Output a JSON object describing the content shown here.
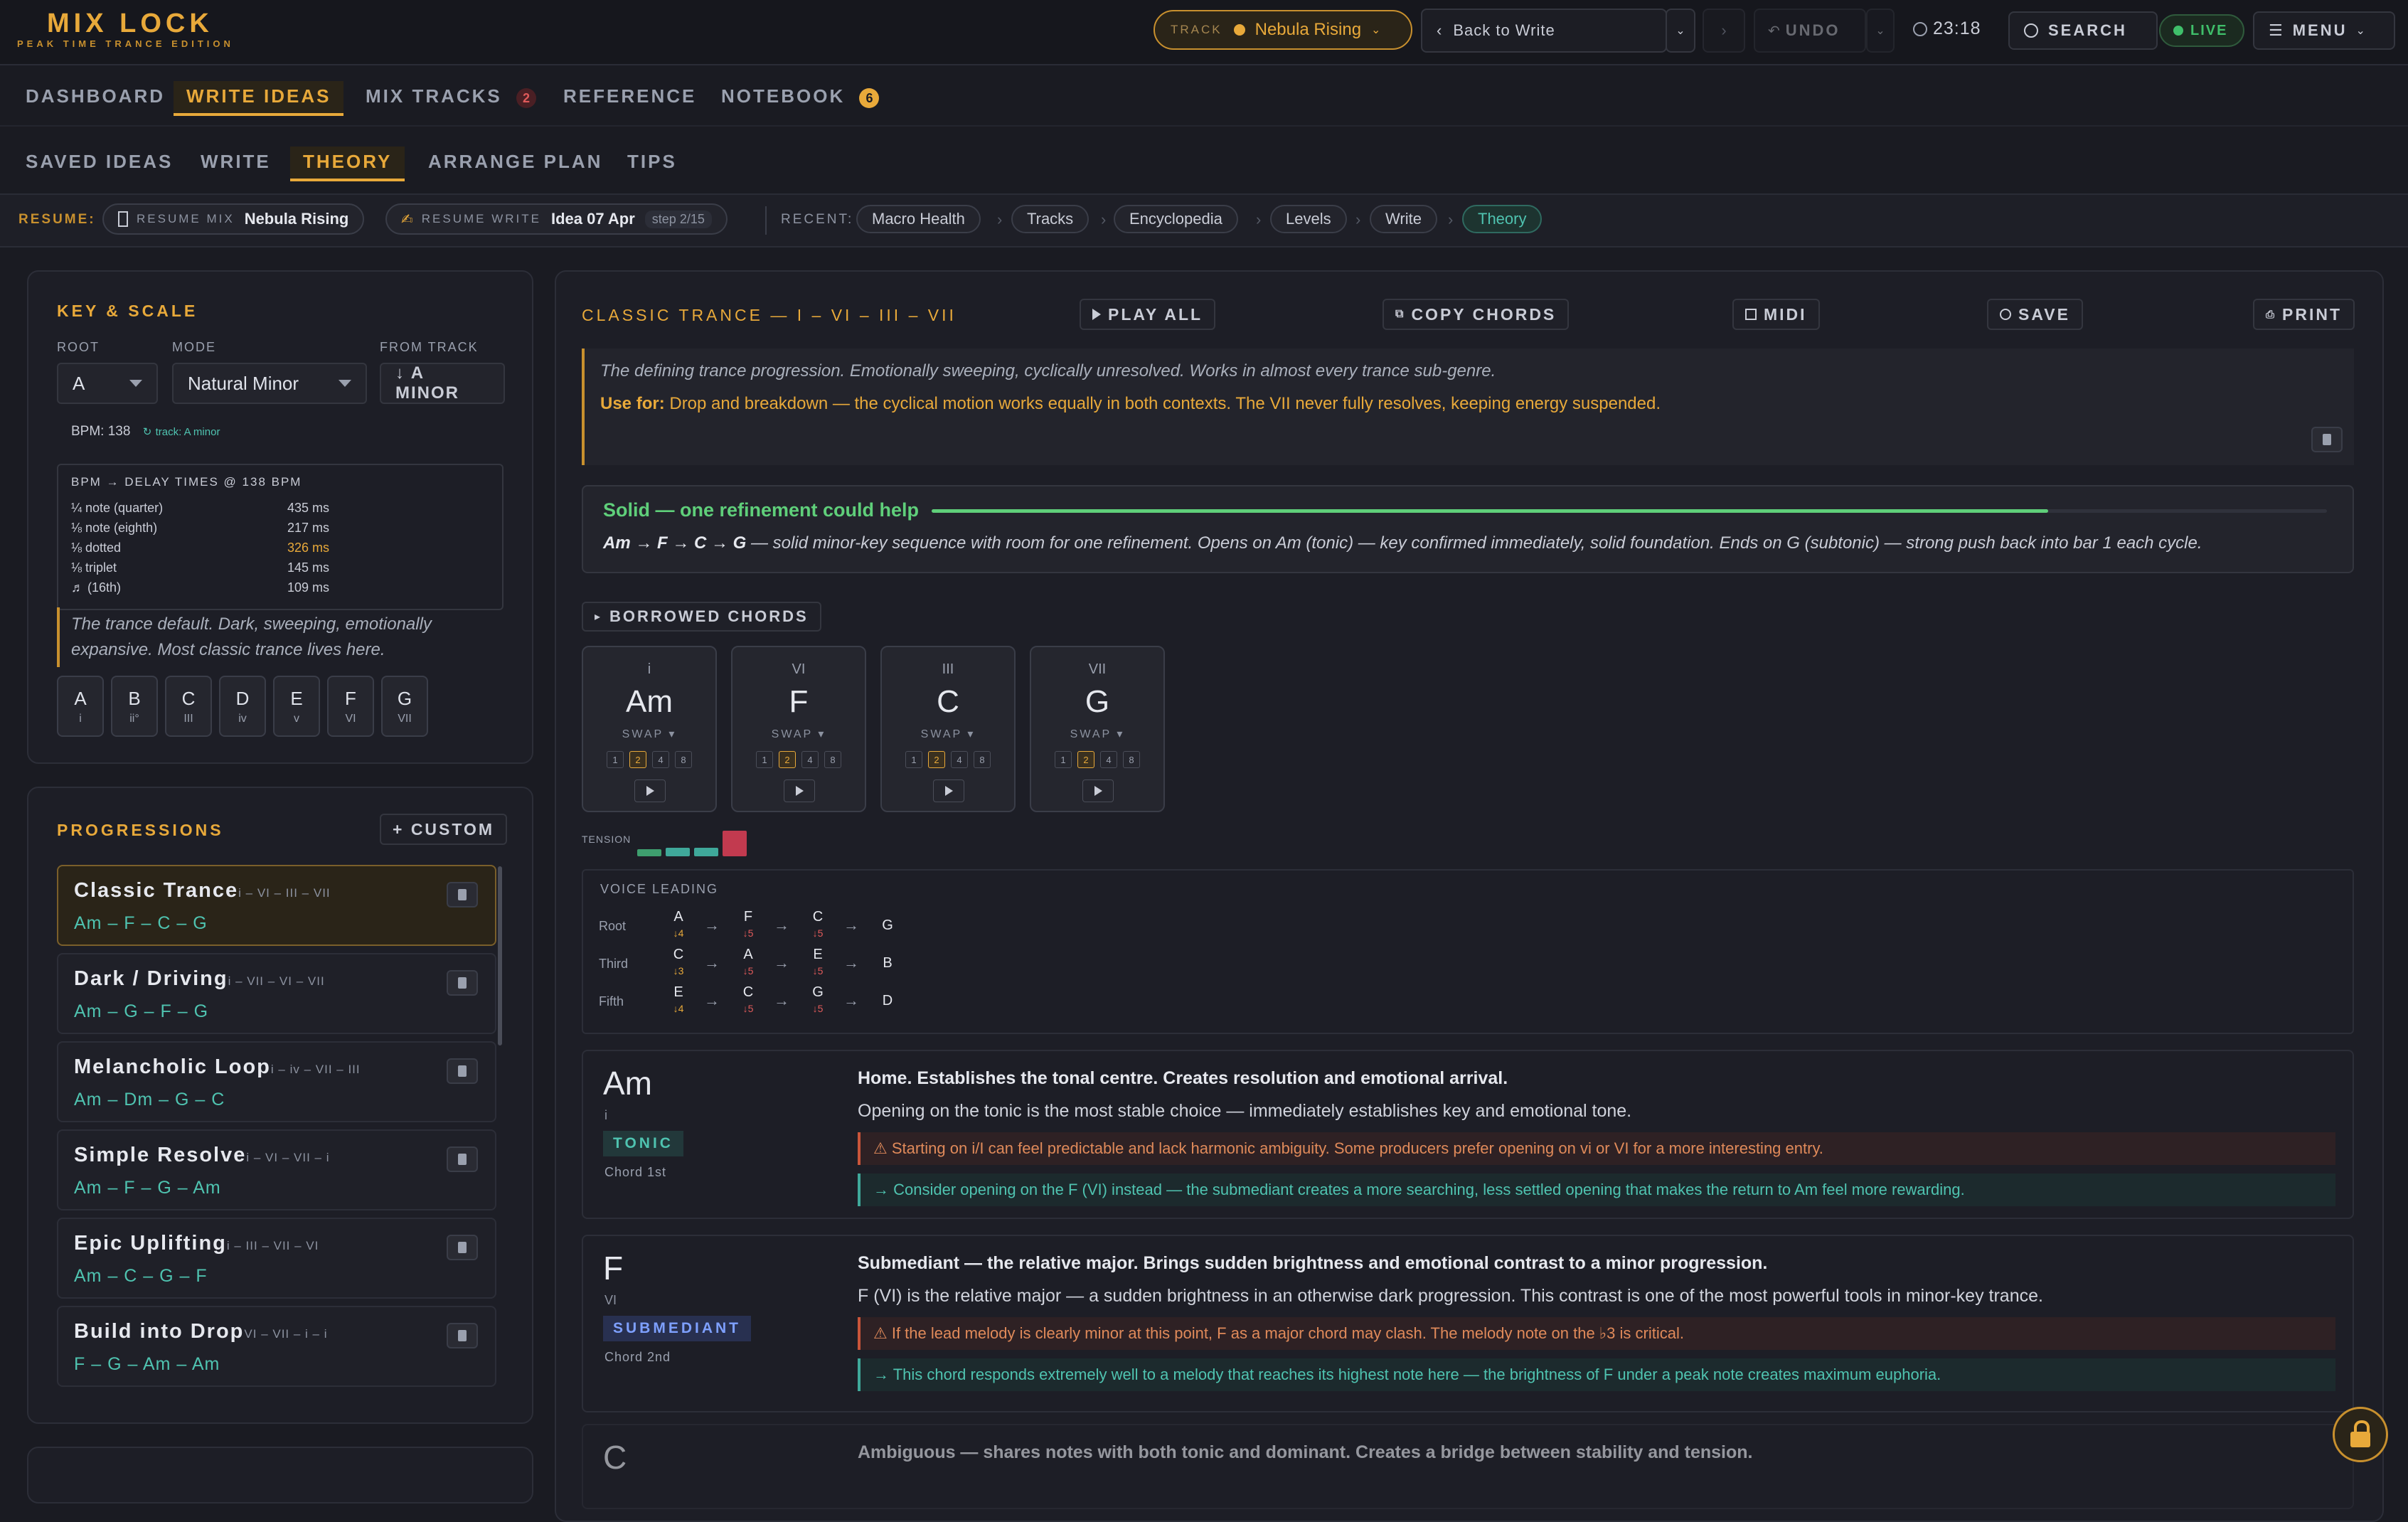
{
  "app": {
    "logo": "MIX LOCK",
    "logo_sub": "PEAK TIME TRANCE EDITION"
  },
  "topbar": {
    "track_label": "TRACK",
    "track_name": "Nebula Rising",
    "back_label": "Back to Write",
    "undo_label": "UNDO",
    "time": "23:18",
    "search_label": "SEARCH",
    "live_label": "LIVE",
    "menu_label": "MENU"
  },
  "nav_main": {
    "items": [
      {
        "label": "DASHBOARD"
      },
      {
        "label": "WRITE IDEAS"
      },
      {
        "label": "MIX TRACKS",
        "badge": "2"
      },
      {
        "label": "REFERENCE"
      },
      {
        "label": "NOTEBOOK",
        "badge": "6"
      }
    ]
  },
  "nav_sub": {
    "items": [
      {
        "label": "SAVED IDEAS"
      },
      {
        "label": "WRITE"
      },
      {
        "label": "THEORY"
      },
      {
        "label": "ARRANGE PLAN"
      },
      {
        "label": "TIPS"
      }
    ]
  },
  "resume": {
    "label": "RESUME:",
    "mix_tag": "RESUME MIX",
    "mix_name": "Nebula Rising",
    "write_tag": "RESUME WRITE",
    "write_name": "Idea 07 Apr",
    "write_step": "step 2/15",
    "recent_label": "RECENT:",
    "recent": [
      "Macro Health",
      "Tracks",
      "Encyclopedia",
      "Levels",
      "Write",
      "Theory"
    ]
  },
  "key_scale": {
    "title": "KEY & SCALE",
    "root_label": "ROOT",
    "root_value": "A",
    "mode_label": "MODE",
    "mode_value": "Natural Minor",
    "from_track_label": "FROM TRACK",
    "from_track_btn": "↓ A MINOR",
    "bpm_text": "BPM: 138",
    "bpm_track": "track: A minor",
    "delay_title": "BPM → DELAY TIMES @ 138 BPM",
    "delays": [
      {
        "note": "¼ note (quarter)",
        "ms": "435 ms"
      },
      {
        "note": "⅛ note (eighth)",
        "ms": "217 ms"
      },
      {
        "note": "⅛ dotted",
        "ms": "326 ms"
      },
      {
        "note": "⅛ triplet",
        "ms": "145 ms"
      },
      {
        "note": "♬ (16th)",
        "ms": "109 ms"
      }
    ],
    "description": "The trance default. Dark, sweeping, emotionally expansive. Most classic trance lives here.",
    "notes": [
      {
        "n": "A",
        "r": "i"
      },
      {
        "n": "B",
        "r": "ii°"
      },
      {
        "n": "C",
        "r": "III"
      },
      {
        "n": "D",
        "r": "iv"
      },
      {
        "n": "E",
        "r": "v"
      },
      {
        "n": "F",
        "r": "VI"
      },
      {
        "n": "G",
        "r": "VII"
      }
    ]
  },
  "progressions": {
    "title": "PROGRESSIONS",
    "custom_btn": "+ CUSTOM",
    "items": [
      {
        "name": "Classic Trance",
        "roman": "i – VI – III – VII",
        "chords": "Am – F – C – G"
      },
      {
        "name": "Dark / Driving",
        "roman": "i – VII – VI – VII",
        "chords": "Am – G – F – G"
      },
      {
        "name": "Melancholic Loop",
        "roman": "i – iv – VII – III",
        "chords": "Am – Dm – G – C"
      },
      {
        "name": "Simple Resolve",
        "roman": "i – VI – VII – i",
        "chords": "Am – F – G – Am"
      },
      {
        "name": "Epic Uplifting",
        "roman": "i – III – VII – VI",
        "chords": "Am – C – G – F"
      },
      {
        "name": "Build into Drop",
        "roman": "VI – VII – i – i",
        "chords": "F – G – Am – Am"
      }
    ]
  },
  "detail": {
    "title": "CLASSIC TRANCE — I – VI – III – VII",
    "buttons": {
      "play_all": "PLAY ALL",
      "copy": "COPY CHORDS",
      "midi": "MIDI",
      "save": "SAVE",
      "print": "PRINT"
    },
    "quote": "The defining trance progression. Emotionally sweeping, cyclically unresolved. Works in almost every trance sub-genre.",
    "use_for_label": "Use for:",
    "use_for_text": "Drop and breakdown — the cyclical motion works equally in both contexts. The VII never fully resolves, keeping energy suspended.",
    "assessment_title": "Solid — one refinement could help",
    "assessment_score": 0.8,
    "assessment_seq": "Am → F → C → G",
    "assessment_text": "— solid minor-key sequence with room for one refinement. Opens on Am (tonic) — key confirmed immediately, solid foundation. Ends on G (subtonic) — strong push back into bar 1 each cycle.",
    "borrowed_label": "BORROWED CHORDS",
    "chords": [
      {
        "roman": "i",
        "name": "Am",
        "swap": "SWAP ▾"
      },
      {
        "roman": "VI",
        "name": "F",
        "swap": "SWAP ▾"
      },
      {
        "roman": "III",
        "name": "C",
        "swap": "SWAP ▾"
      },
      {
        "roman": "VII",
        "name": "G",
        "swap": "SWAP ▾"
      }
    ],
    "beat_options": [
      "1",
      "2",
      "4",
      "8"
    ],
    "tension_label": "TENSION",
    "tension": [
      0.25,
      0.3,
      0.3,
      0.9
    ],
    "tension_colors": [
      "#3e9e6e",
      "#3fa89a",
      "#3fa89a",
      "#c23a4f"
    ],
    "voice_leading": {
      "title": "VOICE LEADING",
      "rows": [
        {
          "label": "Root",
          "notes": [
            "A",
            "F",
            "C",
            "G"
          ],
          "intervals": [
            "↓4",
            "↓5",
            "↓5",
            ""
          ]
        },
        {
          "label": "Third",
          "notes": [
            "C",
            "A",
            "E",
            "B"
          ],
          "intervals": [
            "↓3",
            "↓5",
            "↓5",
            ""
          ]
        },
        {
          "label": "Fifth",
          "notes": [
            "E",
            "C",
            "G",
            "D"
          ],
          "intervals": [
            "↓4",
            "↓5",
            "↓5",
            ""
          ]
        }
      ]
    },
    "chord_details": [
      {
        "name": "Am",
        "roman": "i",
        "function": "TONIC",
        "position": "Chord 1st",
        "headline": "Home. Establishes the tonal centre. Creates resolution and emotional arrival.",
        "desc": "Opening on the tonic is the most stable choice — immediately establishes key and emotional tone.",
        "warn": "⚠ Starting on i/I can feel predictable and lack harmonic ambiguity. Some producers prefer opening on vi or VI for a more interesting entry.",
        "tip": "→ Consider opening on the F (VI) instead — the submediant creates a more searching, less settled opening that makes the return to Am feel more rewarding."
      },
      {
        "name": "F",
        "roman": "VI",
        "function": "SUBMEDIANT",
        "position": "Chord 2nd",
        "headline": "Submediant — the relative major. Brings sudden brightness and emotional contrast to a minor progression.",
        "desc": "F (VI) is the relative major — a sudden brightness in an otherwise dark progression. This contrast is one of the most powerful tools in minor-key trance.",
        "warn": "⚠ If the lead melody is clearly minor at this point, F as a major chord may clash. The melody note on the ♭3 is critical.",
        "tip": "→ This chord responds extremely well to a melody that reaches its highest note here — the brightness of F under a peak note creates maximum euphoria."
      },
      {
        "name": "C",
        "headline": "Ambiguous — shares notes with both tonic and dominant. Creates a bridge between stability and tension."
      }
    ]
  },
  "colors": {
    "accent": "#e8a93a",
    "teal": "#4fc3b0",
    "bg": "#1a1b22"
  }
}
